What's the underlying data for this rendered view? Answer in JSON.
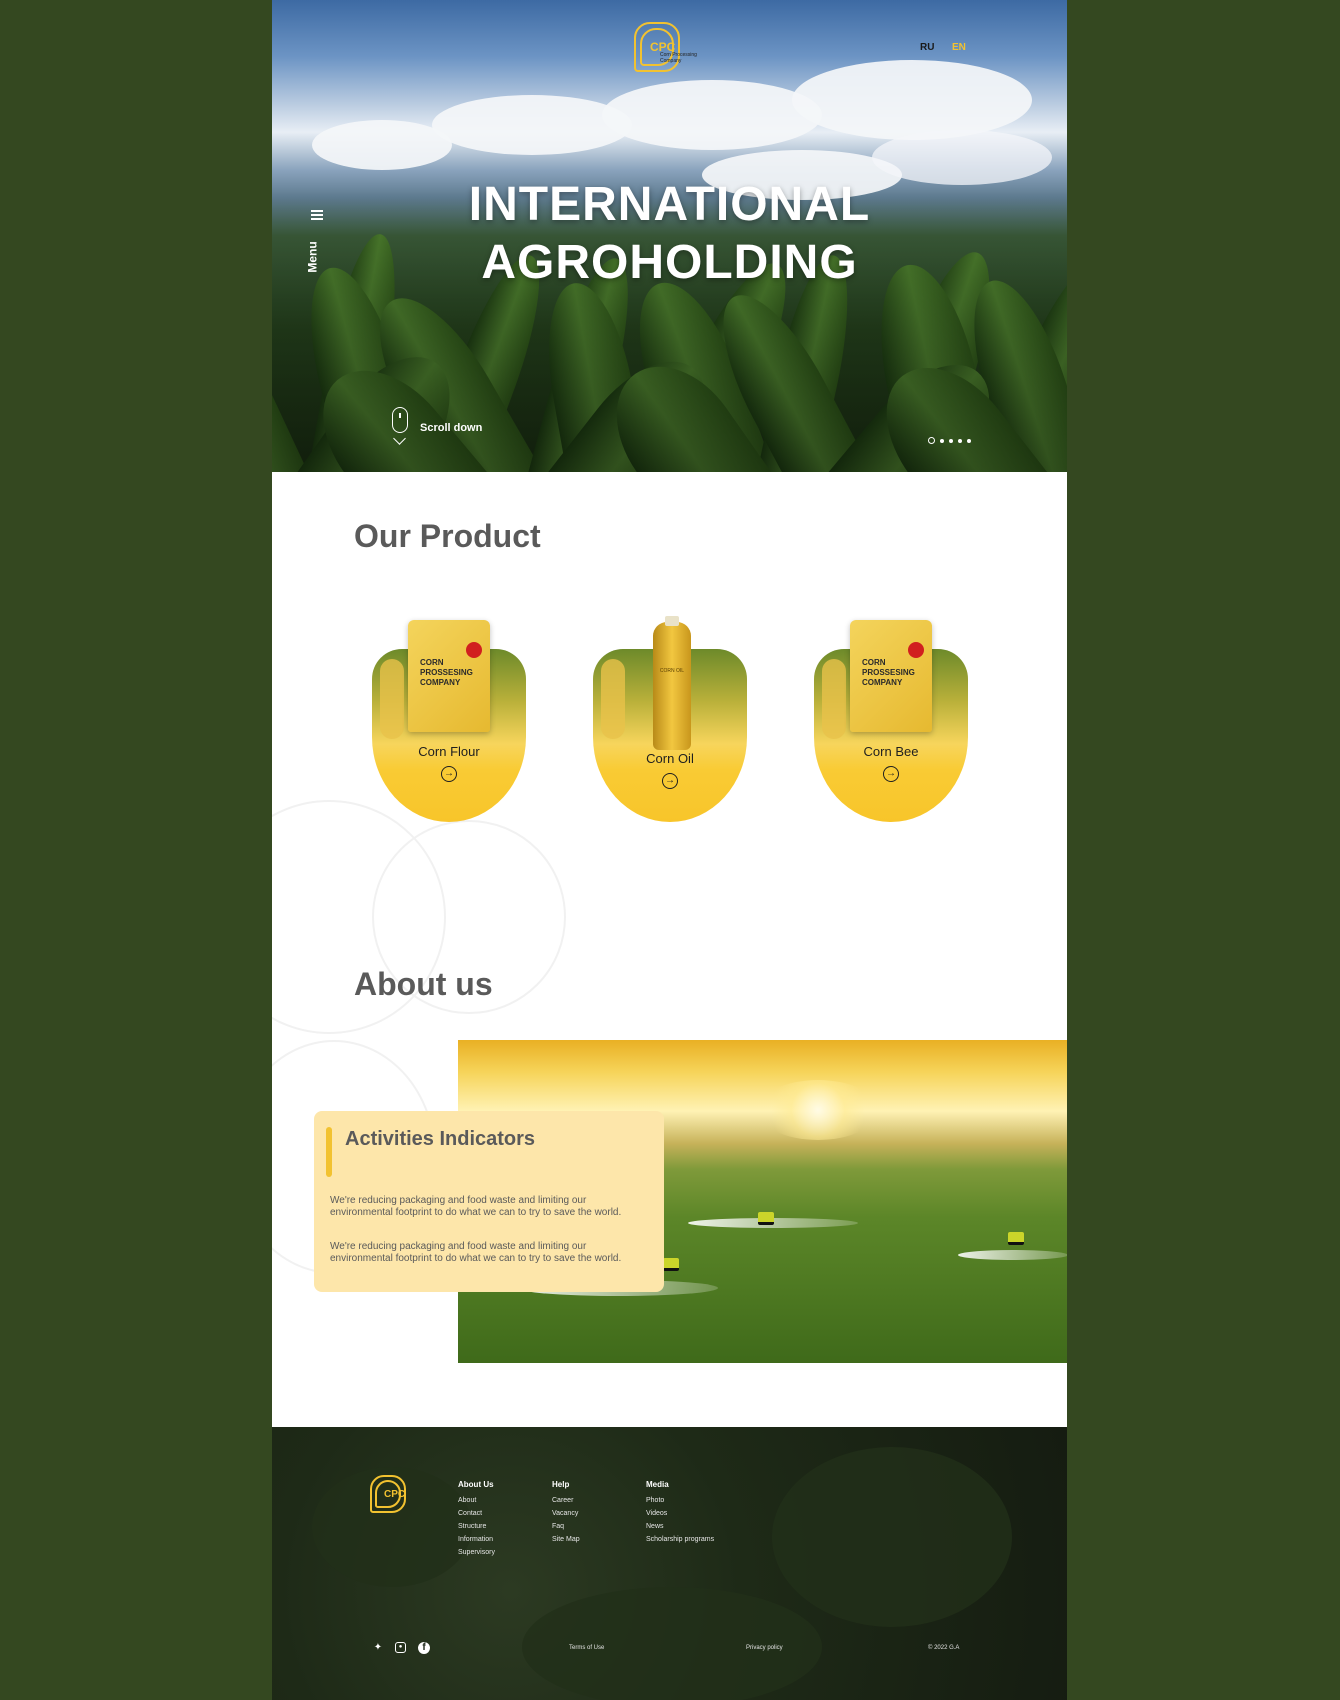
{
  "header": {
    "logo_mark": "CPC",
    "logo_sub": "Corn Processing Company",
    "lang_ru": "RU",
    "lang_en": "EN",
    "menu_label": "Menu"
  },
  "hero": {
    "title_line1": "INTERNATIONAL",
    "title_line2": "AGROHOLDING",
    "scroll_label": "Scroll down",
    "slides_total": 5,
    "slide_active": 1
  },
  "products": {
    "title": "Our Product",
    "items": [
      {
        "name": "Corn Flour",
        "pack_text": "CORN PROSSESING COMPANY"
      },
      {
        "name": "Corn Oil",
        "pack_text": "CORN OIL"
      },
      {
        "name": "Corn Bee",
        "pack_text": "CORN PROSSESING COMPANY"
      }
    ]
  },
  "about": {
    "title": "About us",
    "card_title": "Activities Indicators",
    "paragraph1": "We're reducing packaging and food waste and limiting our environmental footprint to do what we can to try to save the world.",
    "paragraph2": "We're reducing packaging and food waste and limiting our environmental footprint to do what we can to try to save the world."
  },
  "footer": {
    "logo_mark": "CPC",
    "columns": [
      {
        "heading": "About Us",
        "links": [
          "About",
          "Contact",
          "Structure",
          "Information",
          "Supervisory"
        ]
      },
      {
        "heading": "Help",
        "links": [
          "Career",
          "Vacancy",
          "Faq",
          "Site Map"
        ]
      },
      {
        "heading": "Media",
        "links": [
          "Photo",
          "Videos",
          "News",
          "Scholarship programs"
        ]
      }
    ],
    "terms": "Terms of Use",
    "privacy": "Privacy policy",
    "copyright": "© 2022  G.A",
    "social_icons": [
      "twitter-icon",
      "instagram-icon",
      "facebook-icon"
    ]
  },
  "colors": {
    "outer_bg": "#344820",
    "accent": "#f2c230",
    "card_bg": "#fde6aa",
    "title_gray": "#5a5a5a"
  }
}
